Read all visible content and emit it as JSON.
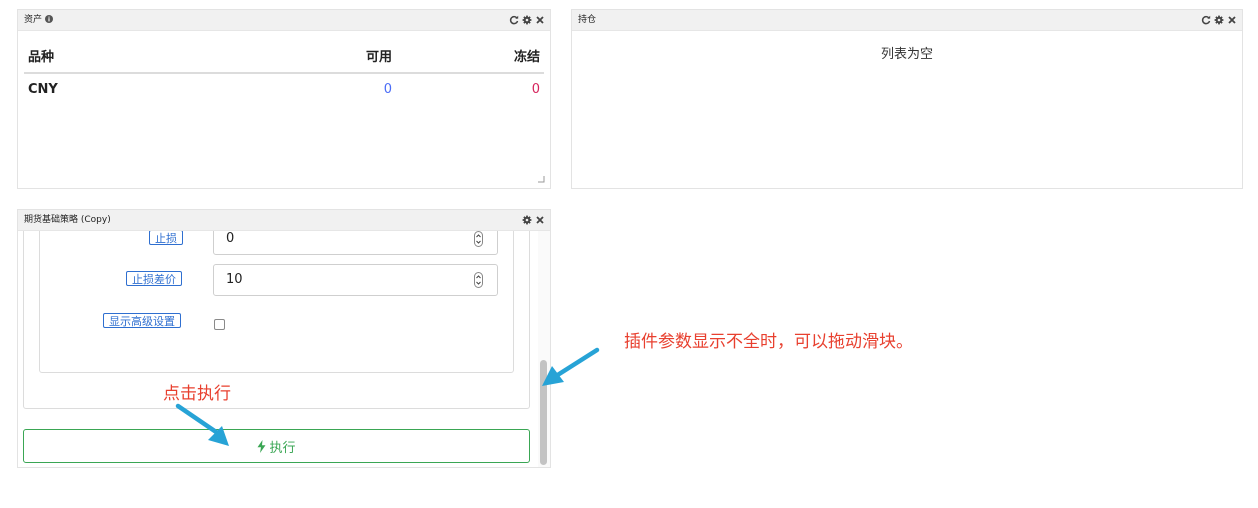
{
  "assets_panel": {
    "title": "资产",
    "columns": [
      "品种",
      "可用",
      "冻结"
    ],
    "rows": [
      {
        "symbol": "CNY",
        "available": "0",
        "frozen": "0"
      }
    ]
  },
  "positions_panel": {
    "title": "持仓",
    "empty_text": "列表为空"
  },
  "strategy_panel": {
    "title": "期货基础策略 (Copy)",
    "params": [
      {
        "label": "止损",
        "value": "0"
      },
      {
        "label": "止损差价",
        "value": "10"
      }
    ],
    "advanced_label": "显示高级设置",
    "execute_label": "执行"
  },
  "annotations": {
    "scroll_hint": "插件参数显示不全时，可以拖动滑块。",
    "execute_hint": "点击执行"
  },
  "colors": {
    "accent_blue": "#2f6fd0",
    "value_blue": "#4a6cf7",
    "value_red": "#d6245c",
    "execute_green": "#3aa654",
    "annotation_red": "#e8402f",
    "arrow_blue": "#27a3d6"
  }
}
